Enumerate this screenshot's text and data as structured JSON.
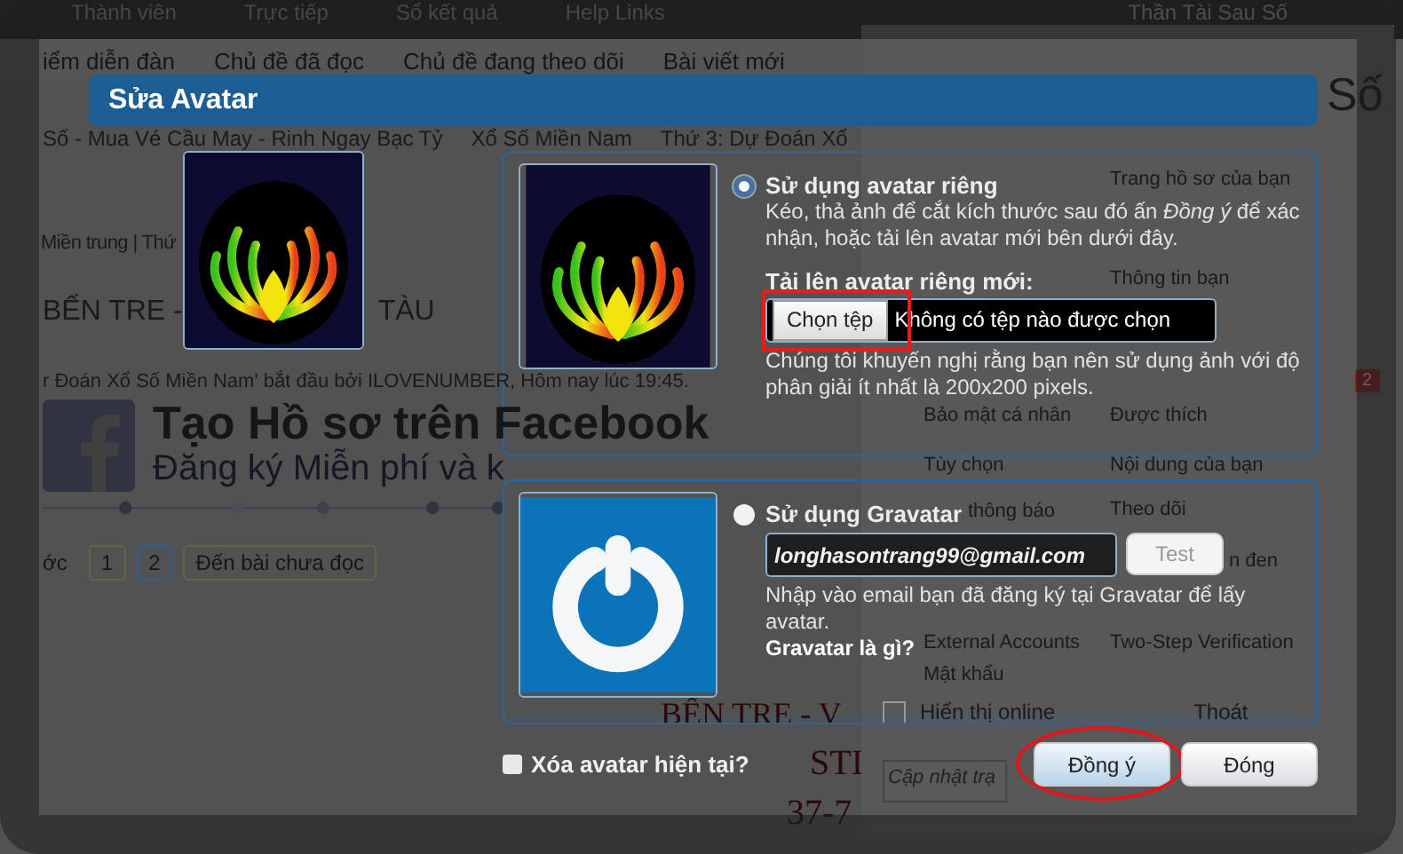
{
  "page": {
    "top_nav": [
      "Thành viên",
      "Trực tiếp",
      "Sổ kết quả",
      "Help Links"
    ],
    "sub_nav": [
      "iểm diễn đàn",
      "Chủ đề đã đọc",
      "Chủ đề đang theo dõi",
      "Bài viết mới"
    ],
    "breadcrumbs": [
      "Số - Mua Vé Cầu May - Rinh Ngay Bạc Tỷ",
      "Xổ Số Miền Nam",
      "Thứ 3: Dự Đoán Xổ"
    ],
    "region_links": "Miền trung | Thứ",
    "thread_title": [
      "BẾN TRE -",
      "TÀU"
    ],
    "thread_meta": "r Đoán Xổ Số Miền Nam' bắt đầu bởi ILOVENUMBER, Hôm nay lúc 19:45.",
    "facebook_banner": {
      "title": "Tạo Hồ sơ trên Facebook",
      "subtitle": "Đăng ký Miễn phí và k"
    },
    "pagination": {
      "prev": "ớc",
      "pages": [
        {
          "label": "1",
          "selected": false
        },
        {
          "label": "2",
          "selected": true
        }
      ],
      "unread": "Đến bài chưa đọc"
    },
    "post_lines": [
      "BẾN TRE - V",
      "STI",
      "37-7"
    ]
  },
  "user_menu": {
    "header": "Thần Tài Sau Số",
    "name": "Số",
    "badge": "2",
    "left_items": [
      "Bảo mật cá nhân",
      "Tùy chọn",
      "thông báo",
      "External Accounts",
      "Mật khẩu"
    ],
    "right_items": [
      "Trang hồ sơ của bạn",
      "Thông tin bạn",
      "Được thích",
      "Nội dung của bạn",
      "Theo dõi",
      "n đen",
      "Two-Step Verification"
    ],
    "online": {
      "label": "Hiển thị online",
      "checked": false
    },
    "logout": "Thoát",
    "status_placeholder": "Cập nhật trạ"
  },
  "dialog": {
    "title": "Sửa Avatar",
    "options": [
      {
        "kind": "custom",
        "selected": true,
        "title": "Sử dụng avatar riêng",
        "description": "Kéo, thả ảnh để cắt kích thước sau đó ấn *Đồng ý* để xác nhận, hoặc tải lên avatar mới bên dưới đây.",
        "upload_label": "Tải lên avatar riêng mới:",
        "file_button": {
          "label": "Chọn tệp",
          "annotated": true
        },
        "file_status": "Không có tệp nào được chọn",
        "note": "Chúng tôi khuyến nghị rằng bạn nên sử dụng ảnh với độ phân giải ít nhất là 200x200 pixels."
      },
      {
        "kind": "gravatar",
        "selected": false,
        "title": "Sử dụng Gravatar",
        "email": "longhasontrang99@gmail.com",
        "test_button": {
          "label": "Test",
          "disabled": true
        },
        "help": "Nhập vào email bạn đã đăng ký tại Gravatar để lấy avatar.",
        "link": "Gravatar là gì?"
      }
    ],
    "delete_current": {
      "label": "Xóa avatar hiện tại?",
      "checked": false
    },
    "buttons": [
      {
        "label": "Đồng ý",
        "kind": "primary",
        "annotated": true
      },
      {
        "label": "Đóng",
        "kind": "secondary",
        "annotated": false
      }
    ]
  }
}
